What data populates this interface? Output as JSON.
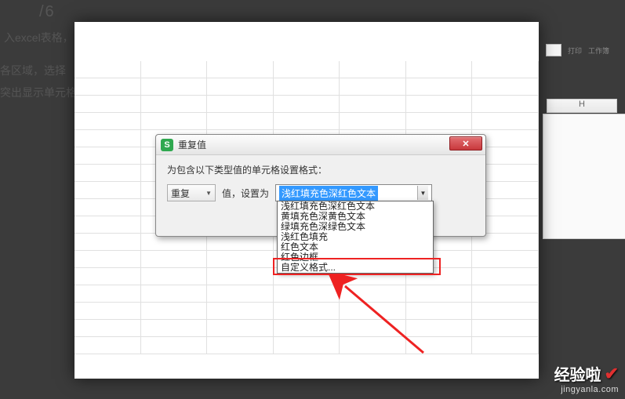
{
  "background": {
    "partial_text_1": "入excel表格，",
    "partial_text_2": "各区域，选择",
    "partial_text_3": "/6",
    "partial_text_4": "突出显示单元格"
  },
  "ribbon": {
    "label_1": "打印",
    "label_2": "工作簿"
  },
  "column_header": "H",
  "dialog": {
    "title": "重复值",
    "body_text": "为包含以下类型值的单元格设置格式：",
    "type_select": "重复",
    "mid_label": "值，设置为",
    "format_selected": "浅红填充色深红色文本"
  },
  "dropdown": {
    "options": [
      "浅红填充色深红色文本",
      "黄填充色深黄色文本",
      "绿填充色深绿色文本",
      "浅红色填充",
      "红色文本",
      "红色边框",
      "自定义格式..."
    ]
  },
  "watermark": {
    "main": "经验啦",
    "sub": "jingyanla.com"
  }
}
